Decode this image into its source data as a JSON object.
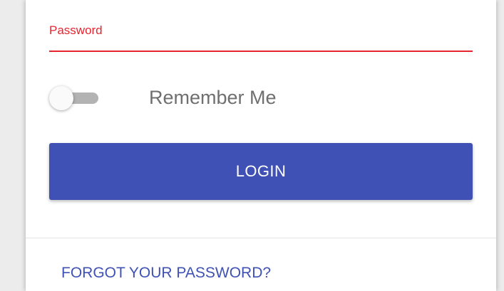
{
  "login_form": {
    "password_field": {
      "label": "Password",
      "value": ""
    },
    "remember_me": {
      "label": "Remember Me",
      "checked": false
    },
    "login_button_label": "LOGIN",
    "forgot_password_link": "FORGOT YOUR PASSWORD?"
  },
  "colors": {
    "accent": "#3f51b5",
    "error": "#e8242e",
    "switch_track_off": "#b3b3b3",
    "label_text": "#6f6f6f"
  }
}
